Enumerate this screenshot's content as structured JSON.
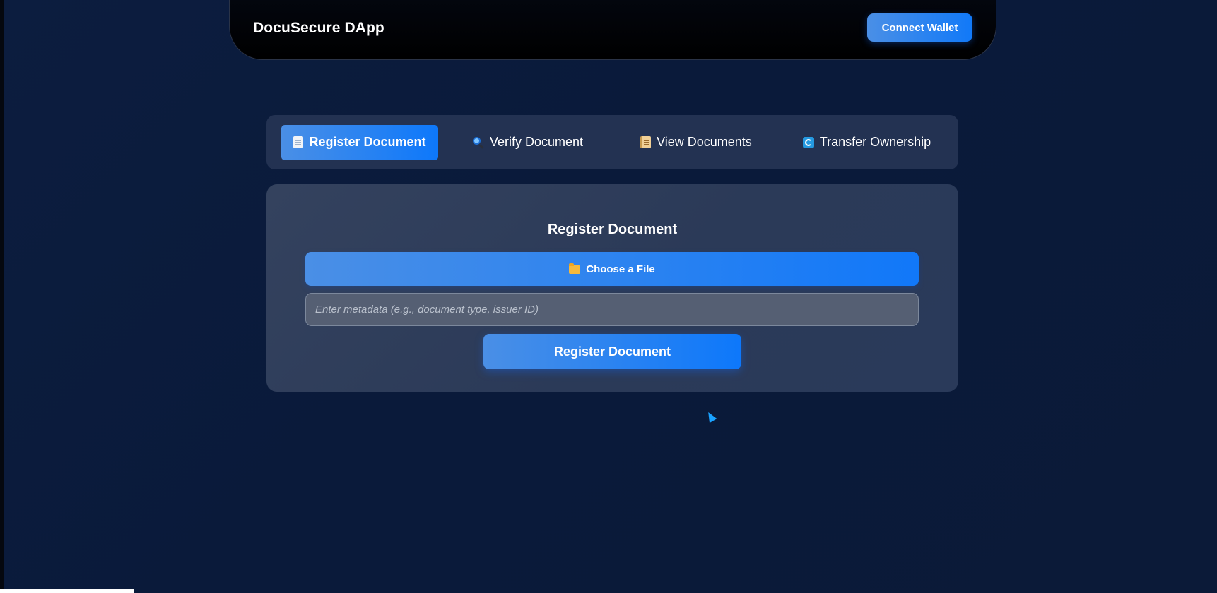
{
  "app": {
    "title": "DocuSecure DApp"
  },
  "header": {
    "connect_label": "Connect Wallet"
  },
  "tabs": [
    {
      "label": "Register Document",
      "icon": "page-icon",
      "active": true
    },
    {
      "label": "Verify Document",
      "icon": "magnifier-icon",
      "active": false
    },
    {
      "label": "View Documents",
      "icon": "scroll-icon",
      "active": false
    },
    {
      "label": "Transfer Ownership",
      "icon": "cycle-arrows-icon",
      "active": false
    }
  ],
  "register": {
    "title": "Register Document",
    "file_button_label": "Choose a File",
    "file_button_icon": "folder-icon",
    "metadata_value": "",
    "metadata_placeholder": "Enter metadata (e.g., document type, issuer ID)",
    "submit_label": "Register Document"
  },
  "colors": {
    "background": "#0b1b3b",
    "accent": "#1179f8",
    "accent_light": "#4a8fe6",
    "card": "#2e3d5a",
    "tab_bar": "#233252",
    "header": "#000000"
  }
}
